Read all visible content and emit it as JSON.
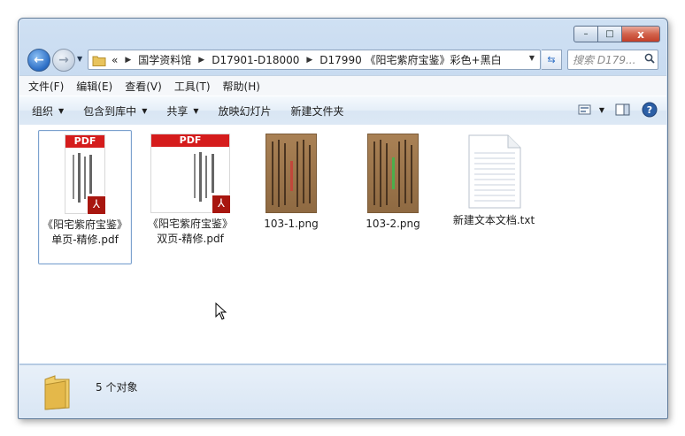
{
  "window": {
    "caption": {
      "minimize": "–",
      "maximize": "□",
      "close": "x"
    }
  },
  "nav": {
    "back_glyph": "←",
    "forward_glyph": "→",
    "breadcrumbs": [
      "国学资料馆",
      "D17901-D18000",
      "D17990 《阳宅紫府宝鉴》彩色+黑白"
    ],
    "overflow_glyph": "«",
    "search_placeholder": "搜索 D179..."
  },
  "menu": [
    "文件(F)",
    "编辑(E)",
    "查看(V)",
    "工具(T)",
    "帮助(H)"
  ],
  "commands": [
    {
      "label": "组织",
      "dropdown": true
    },
    {
      "label": "包含到库中",
      "dropdown": true
    },
    {
      "label": "共享",
      "dropdown": true
    },
    {
      "label": "放映幻灯片",
      "dropdown": false
    },
    {
      "label": "新建文件夹",
      "dropdown": false
    }
  ],
  "files": [
    {
      "name": "《阳宅紫府宝鉴》单页-精修.pdf",
      "type": "pdf",
      "thumb_text": "PDF",
      "selected": true
    },
    {
      "name": "《阳宅紫府宝鉴》双页-精修.pdf",
      "type": "pdf",
      "thumb_text": "PDF",
      "selected": false
    },
    {
      "name": "103-1.png",
      "type": "png",
      "selected": false
    },
    {
      "name": "103-2.png",
      "type": "png",
      "selected": false
    },
    {
      "name": "新建文本文档.txt",
      "type": "txt",
      "selected": false
    }
  ],
  "status": {
    "item_count": "5 个对象"
  },
  "colors": {
    "pdf_red": "#d51c1c",
    "acrobat": "#a8160f",
    "folder": "#e8c35c"
  }
}
